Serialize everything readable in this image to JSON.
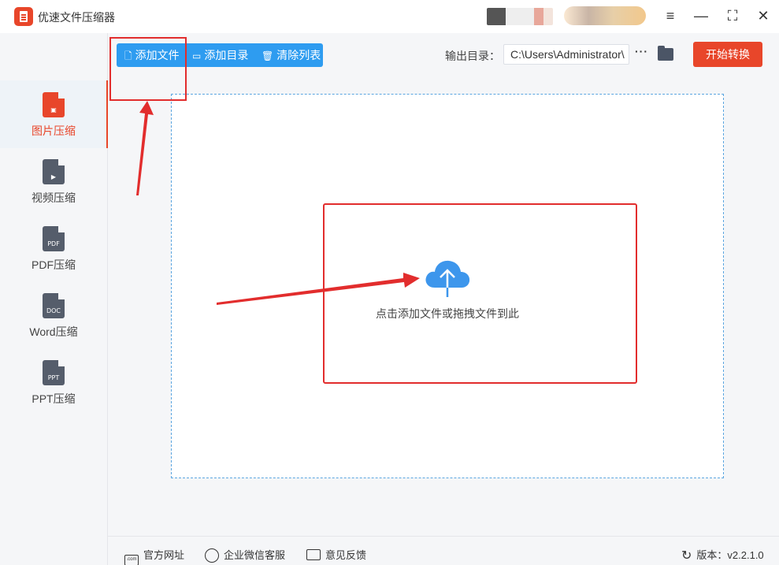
{
  "window": {
    "title": "优速文件压缩器",
    "controls": {
      "menu": "≡",
      "minimize": "—",
      "maximize": "⛶",
      "close": "✕"
    }
  },
  "sidebar": {
    "items": [
      {
        "label": "图片压缩",
        "icon": "image-file-icon",
        "glyph": "▣",
        "active": true
      },
      {
        "label": "视频压缩",
        "icon": "video-file-icon",
        "glyph": "▶",
        "active": false
      },
      {
        "label": "PDF压缩",
        "icon": "pdf-file-icon",
        "glyph": "PDF",
        "active": false
      },
      {
        "label": "Word压缩",
        "icon": "doc-file-icon",
        "glyph": "DOC",
        "active": false
      },
      {
        "label": "PPT压缩",
        "icon": "ppt-file-icon",
        "glyph": "PPT",
        "active": false
      }
    ]
  },
  "toolbar": {
    "add_file": "添加文件",
    "add_dir": "添加目录",
    "clear_list": "清除列表",
    "output_label": "输出目录：",
    "output_path": "C:\\Users\\Administrator\\",
    "more": "···",
    "start": "开始转换"
  },
  "dropzone": {
    "text": "点击添加文件或拖拽文件到此"
  },
  "footer": {
    "site": "官方网址",
    "site_icon_text": ".com",
    "wechat": "企业微信客服",
    "feedback": "意见反馈",
    "version": "版本：v2.2.1.0"
  },
  "colors": {
    "accent_orange": "#e8462a",
    "toolbar_blue": "#2e9cf0",
    "annotation_red": "#e22d2d",
    "cloud_blue": "#3d96ec"
  }
}
